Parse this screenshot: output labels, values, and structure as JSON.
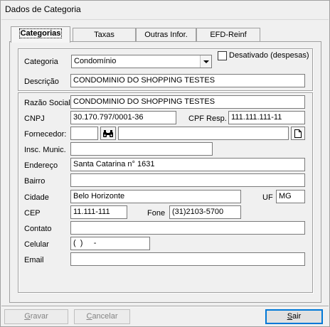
{
  "window": {
    "title": "Dados de Categoria"
  },
  "tabs": [
    {
      "label": "Categorias",
      "active": true
    },
    {
      "label": "Taxas",
      "active": false
    },
    {
      "label": "Outras Infor.",
      "active": false
    },
    {
      "label": "EFD-Reinf",
      "active": false
    }
  ],
  "form": {
    "categoria_label": "Categoria",
    "categoria_value": "Condomínio",
    "desativado_label": "Desativado (despesas)",
    "desativado_checked": false,
    "descricao_label": "Descrição",
    "descricao_value": "CONDOMINIO DO SHOPPING TESTES",
    "razao_label": "Razão Social",
    "razao_value": "CONDOMINIO DO SHOPPING TESTES",
    "cnpj_label": "CNPJ",
    "cnpj_value": "30.170.797/0001-36",
    "cpf_label": "CPF Resp.",
    "cpf_value": "111.111.111-11",
    "fornecedor_label": "Fornecedor:",
    "fornecedor_code": "",
    "fornecedor_name": "",
    "insc_label": "Insc. Munic.",
    "insc_value": "",
    "endereco_label": "Endereço",
    "endereco_value": "Santa Catarina n° 1631",
    "bairro_label": "Bairro",
    "bairro_value": "",
    "cidade_label": "Cidade",
    "cidade_value": "Belo Horizonte",
    "uf_label": "UF",
    "uf_value": "MG",
    "cep_label": "CEP",
    "cep_value": "11.111-111",
    "fone_label": "Fone",
    "fone_value": "(31)2103-5700",
    "contato_label": "Contato",
    "contato_value": "",
    "celular_label": "Celular",
    "celular_value": "(  )     -",
    "email_label": "Email",
    "email_value": ""
  },
  "buttons": {
    "gravar": {
      "prefix": "",
      "hotkey": "G",
      "rest": "ravar",
      "enabled": false
    },
    "cancelar": {
      "prefix": "",
      "hotkey": "C",
      "rest": "ancelar",
      "enabled": false
    },
    "sair": {
      "prefix": "",
      "hotkey": "S",
      "rest": "air",
      "enabled": true
    }
  },
  "icons": {
    "search": "binoculars-icon",
    "new": "new-document-icon"
  }
}
